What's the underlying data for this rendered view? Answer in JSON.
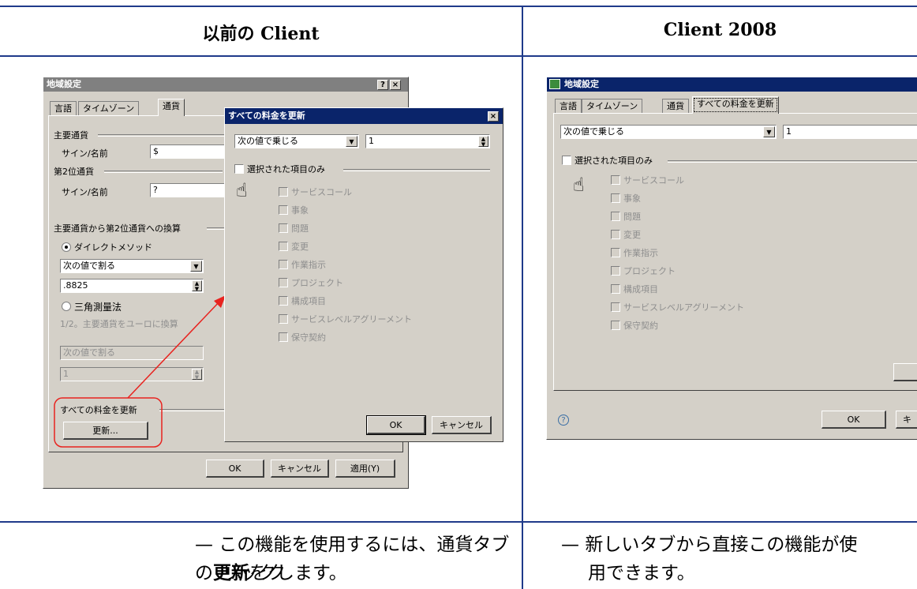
{
  "columns": {
    "left_title": "以前の Client",
    "right_title": "Client 2008"
  },
  "old_dialog": {
    "title": "地域設定",
    "title_buttons": [
      "?",
      "×"
    ],
    "tabs": [
      "言語",
      "タイムゾーン",
      "通貨"
    ],
    "primary_currency_group": "主要通貨",
    "sign_name_label": "サイン/名前",
    "primary_sign_value": "$",
    "secondary_currency_group": "第2位通貨",
    "secondary_sign_label": "サイン/名前",
    "secondary_sign_value": "?",
    "conversion_group": "主要通貨から第2位通貨への換算",
    "direct_method": "ダイレクトメソッド",
    "direct_select": "次の値で割る",
    "direct_rate": ".8825",
    "triangulation": "三角測量法",
    "triangulation_note": "1/2。主要通貨をユーロに換算",
    "tri_select": "次の値で割る",
    "tri_rate": "1",
    "update_all_group": "すべての料金を更新",
    "update_button": "更新...",
    "ok_button": "OK",
    "cancel_button": "キャンセル",
    "apply_button": "適用(Y)"
  },
  "popup_dialog": {
    "title": "すべての料金を更新",
    "close": "×",
    "operation": "次の値で乗じる",
    "value": "1",
    "selected_only": "選択された項目のみ",
    "items": [
      "サービスコール",
      "事象",
      "問題",
      "変更",
      "作業指示",
      "プロジェクト",
      "構成項目",
      "サービスレベルアグリーメント",
      "保守契約"
    ],
    "ok_button": "OK",
    "cancel_button": "キャンセル"
  },
  "new_dialog": {
    "title": "地域設定",
    "tabs": [
      "言語",
      "タイムゾーン",
      "通貨",
      "すべての料金を更新"
    ],
    "operation": "次の値で乗じる",
    "value": "1",
    "selected_only": "選択された項目のみ",
    "items": [
      "サービスコール",
      "事象",
      "問題",
      "変更",
      "作業指示",
      "プロジェクト",
      "構成項目",
      "サービスレベルアグリーメント",
      "保守契約"
    ],
    "help": "?",
    "ok_button": "OK",
    "cancel_partial": "キ"
  },
  "descriptions": {
    "left_dash": "—",
    "left_part1": "この機能を使用するには、通貨タブの",
    "left_bold": "更新",
    "left_part2": "をク",
    "left_line2": "リックします。",
    "right_dash": "—",
    "right_line1": "新しいタブから直接この機能が使",
    "right_line2": "用できます。"
  },
  "colors": {
    "rule": "#1f3a8a",
    "highlight": "#e8231f",
    "dialog_face": "#d4d0c8",
    "title_active": "#0a246a"
  }
}
